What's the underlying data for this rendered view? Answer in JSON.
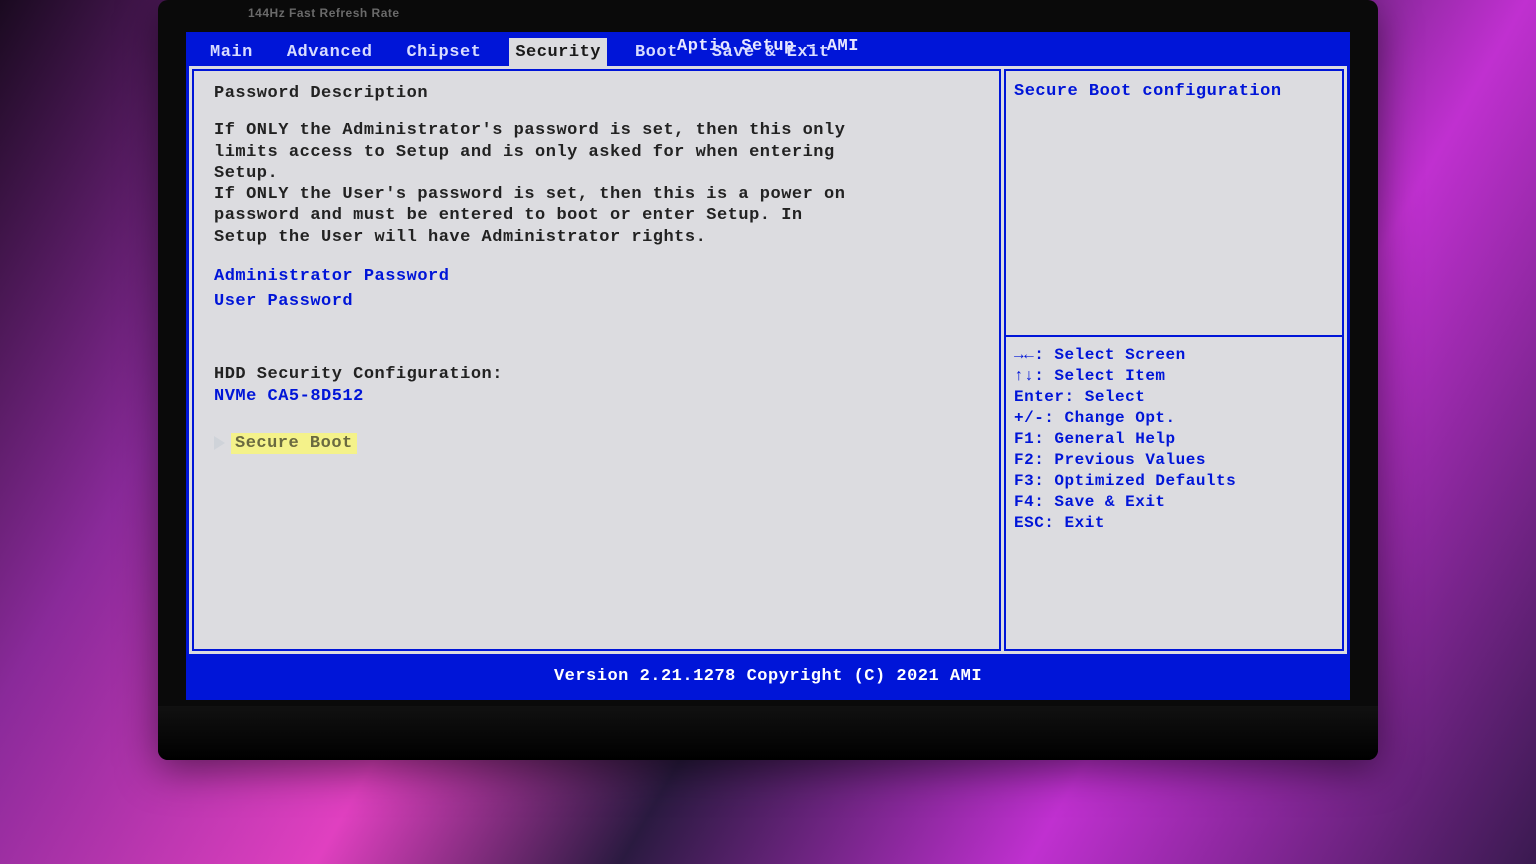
{
  "monitor_badge": "144Hz Fast Refresh Rate",
  "header": {
    "title": "Aptio Setup – AMI",
    "tabs": [
      {
        "label": "Main"
      },
      {
        "label": "Advanced"
      },
      {
        "label": "Chipset"
      },
      {
        "label": "Security"
      },
      {
        "label": "Boot"
      },
      {
        "label": "Save & Exit"
      }
    ],
    "active_index": 3
  },
  "main": {
    "section_title": "Password Description",
    "description": "If ONLY the Administrator's password is set, then this only limits access to Setup and is only asked for when entering Setup.\nIf ONLY the User's password is set, then this is a power on password and must be entered to boot or enter Setup. In Setup the User will have Administrator rights.",
    "items": {
      "admin_pw": "Administrator Password",
      "user_pw": "User Password",
      "hdd_header": "HDD Security Configuration:",
      "hdd_device": "NVMe CA5-8D512",
      "secure_boot": "Secure Boot"
    }
  },
  "help": {
    "text": "Secure Boot configuration"
  },
  "keys": [
    "→←: Select Screen",
    "↑↓: Select Item",
    "Enter: Select",
    "+/-: Change Opt.",
    "F1: General Help",
    "F2: Previous Values",
    "F3: Optimized Defaults",
    "F4: Save & Exit",
    "ESC: Exit"
  ],
  "footer": {
    "copyright": "Version 2.21.1278 Copyright (C) 2021 AMI"
  }
}
